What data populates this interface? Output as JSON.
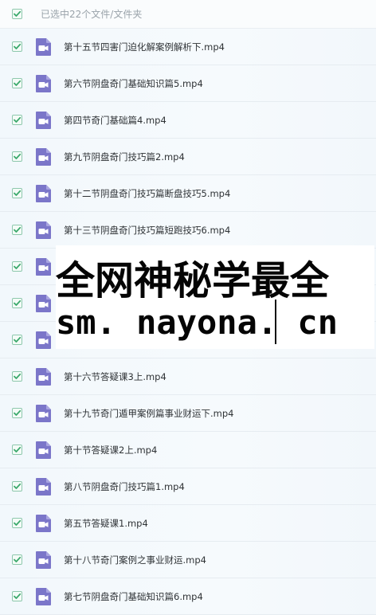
{
  "header": {
    "selection_text": "已选中22个文件/文件夹",
    "checked": true
  },
  "files": [
    {
      "name": "第十五节四害门迫化解案例解析下.mp4",
      "checked": true,
      "icon": "video-file-icon"
    },
    {
      "name": "第六节阴盘奇门基础知识篇5.mp4",
      "checked": true,
      "icon": "video-file-icon"
    },
    {
      "name": "第四节奇门基础篇4.mp4",
      "checked": true,
      "icon": "video-file-icon"
    },
    {
      "name": "第九节阴盘奇门技巧篇2.mp4",
      "checked": true,
      "icon": "video-file-icon"
    },
    {
      "name": "第十二节阴盘奇门技巧篇断盘技巧5.mp4",
      "checked": true,
      "icon": "video-file-icon"
    },
    {
      "name": "第十三节阴盘奇门技巧篇短跑技巧6.mp4",
      "checked": true,
      "icon": "video-file-icon"
    },
    {
      "name": "",
      "checked": true,
      "icon": "video-file-icon"
    },
    {
      "name": "",
      "checked": true,
      "icon": "video-file-icon"
    },
    {
      "name": "",
      "checked": true,
      "icon": "video-file-icon"
    },
    {
      "name": "第十六节答疑课3上.mp4",
      "checked": true,
      "icon": "video-file-icon"
    },
    {
      "name": "第十九节奇门遁甲案例篇事业财运下.mp4",
      "checked": true,
      "icon": "video-file-icon"
    },
    {
      "name": "第十节答疑课2上.mp4",
      "checked": true,
      "icon": "video-file-icon"
    },
    {
      "name": "第八节阴盘奇门技巧篇1.mp4",
      "checked": true,
      "icon": "video-file-icon"
    },
    {
      "name": "第五节答疑课1.mp4",
      "checked": true,
      "icon": "video-file-icon"
    },
    {
      "name": "第十八节奇门案例之事业财运.mp4",
      "checked": true,
      "icon": "video-file-icon"
    },
    {
      "name": "第七节阴盘奇门基础知识篇6.mp4",
      "checked": true,
      "icon": "video-file-icon"
    }
  ],
  "watermark": {
    "line1": "全网神秘学最全",
    "line2": "sm. nayona. cn"
  },
  "colors": {
    "checkbox_green": "#3aa86b",
    "icon_purple": "#7b76c9",
    "row_bg": "#f4f9fc"
  }
}
